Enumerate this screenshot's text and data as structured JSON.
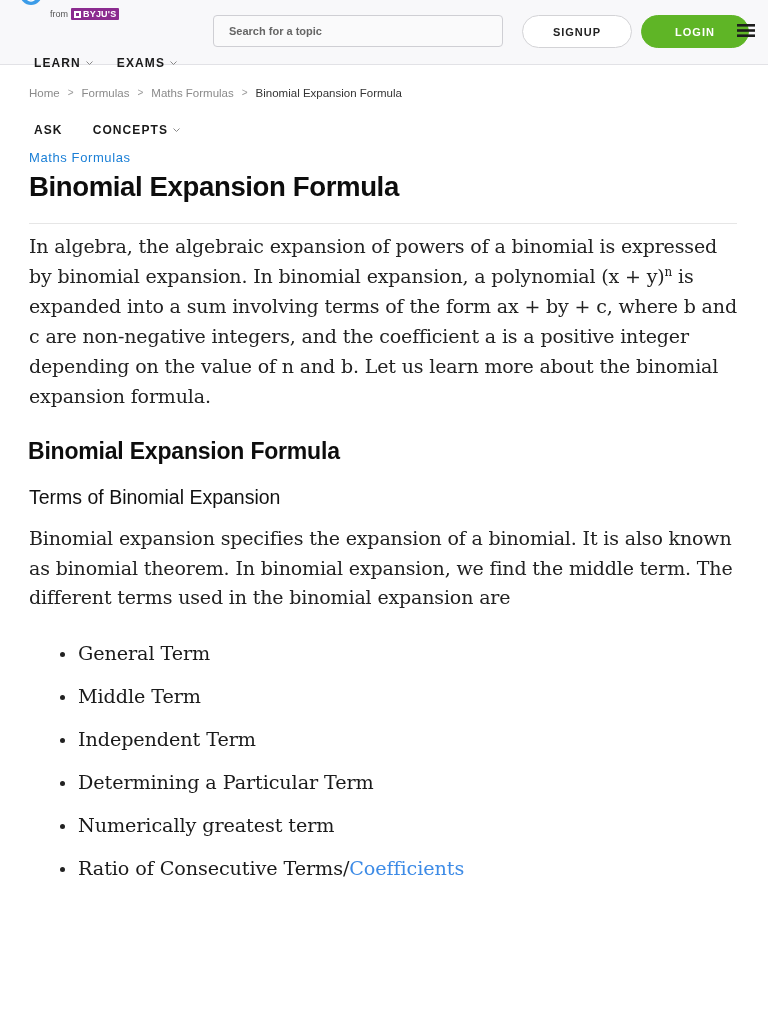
{
  "header": {
    "logo": {
      "from": "from",
      "brand": "BYJU'S"
    },
    "search": {
      "placeholder": "Search for a topic"
    },
    "buttons": [
      {
        "label": "SIGNUP",
        "kind": "outline"
      },
      {
        "label": "LOGIN",
        "kind": "filled"
      }
    ]
  },
  "nav": [
    {
      "label": "LEARN",
      "dropdown": true
    },
    {
      "label": "EXAMS",
      "dropdown": true
    }
  ],
  "breadcrumb": {
    "separator": ">",
    "items": [
      "Home",
      "Formulas",
      "Maths Formulas",
      "Binomial Expansion Formula"
    ]
  },
  "subnav": [
    {
      "label": "ASK",
      "dropdown": false
    },
    {
      "label": "CONCEPTS",
      "dropdown": true
    }
  ],
  "article": {
    "category": "Maths Formulas",
    "title": "Binomial Expansion Formula",
    "intro": "In algebra, the algebraic expansion of powers of a binomial is expressed by binomial expansion. In binomial expansion, a polynomial (x + y)$^{n}$ is expanded into a sum involving terms of the form ax + by + c, where b and c are non-negative integers, and the coefficient a is a positive integer depending on the value of n and b. Let us learn more about the binomial expansion formula.",
    "sections": [
      {
        "heading": "Binomial Expansion Formula",
        "subheading": "Terms of Binomial Expansion",
        "paragraph": "Binomial expansion specifies the expansion of a binomial. It is also known as binomial theorem. In binomial expansion, we find the middle term. The different terms used in the binomial expansion are",
        "list": [
          {
            "text": "General Term"
          },
          {
            "text": "Middle Term"
          },
          {
            "text": "Independent Term"
          },
          {
            "text": "Determining a Particular Term"
          },
          {
            "text": "Numerically greatest term"
          },
          {
            "text": "Ratio of Consecutive Terms/",
            "link": "Coefficients"
          }
        ]
      }
    ]
  }
}
